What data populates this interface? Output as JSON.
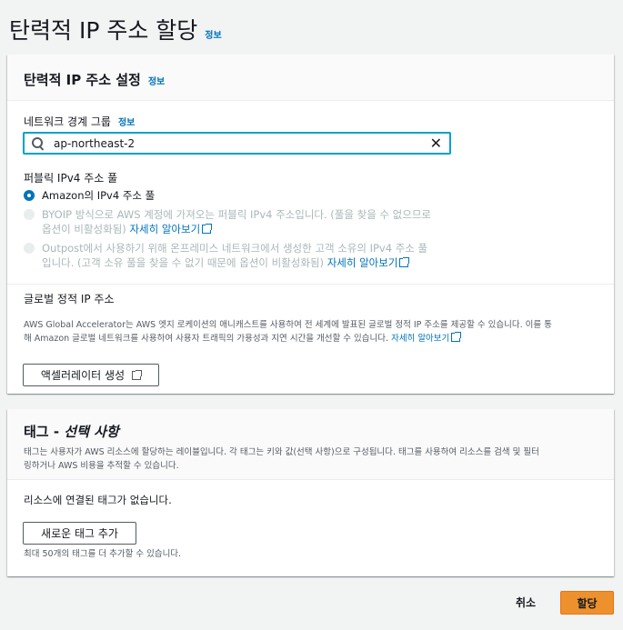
{
  "page": {
    "title": "탄력적 IP 주소 할당",
    "info": "정보"
  },
  "settings": {
    "title": "탄력적 IP 주소 설정",
    "info": "정보",
    "network_border_group": {
      "label": "네트워크 경계 그룹",
      "info": "정보",
      "value": "ap-northeast-2"
    },
    "pool": {
      "label": "퍼블릭 IPv4 주소 풀",
      "options": [
        {
          "label": "Amazon의 IPv4 주소 풀",
          "checked": true,
          "disabled": false
        },
        {
          "line1": "BYOIP 방식으로 AWS 계정에 가져오는 퍼블릭 IPv4 주소입니다. (풀을 찾을 수 없으므로",
          "line2": "옵션이 비활성화됨)",
          "link": "자세히 알아보기",
          "checked": false,
          "disabled": true
        },
        {
          "line1": "Outpost에서 사용하기 위해 온프레미스 네트워크에서 생성한 고객 소유의 IPv4 주소 풀",
          "line2": "입니다. (고객 소유 풀을 찾을 수 없기 때문에 옵션이 비활성화됨)",
          "link": "자세히 알아보기",
          "checked": false,
          "disabled": true
        }
      ]
    },
    "global": {
      "label": "글로벌 정적 IP 주소",
      "desc1": "AWS Global Accelerator는 AWS 엣지 로케이션의 애니캐스트를 사용하여 전 세계에 발표된 글로벌 정적 IP 주소를 제공할 수 있습니다. 이를 통",
      "desc2": "해 Amazon 글로벌 네트워크를 사용하여 사용자 트래픽의 가용성과 지연 시간을 개선할 수 있습니다.",
      "link": "자세히 알아보기",
      "button": "액셀러레이터 생성"
    }
  },
  "tags": {
    "title_main": "태그 - ",
    "title_italic": "선택 사항",
    "desc1": "태그는 사용자가 AWS 리소스에 할당하는 레이블입니다. 각 태그는 키와 값(선택 사항)으로 구성됩니다. 태그를 사용하여 리소스를 검색 및 필터",
    "desc2": "링하거나 AWS 비용을 추적할 수 있습니다.",
    "empty": "리소스에 연결된 태그가 없습니다.",
    "add_button": "새로운 태그 추가",
    "limit": "최대 50개의 태그를 더 추가할 수 있습니다."
  },
  "footer": {
    "cancel": "취소",
    "assign": "할당"
  }
}
